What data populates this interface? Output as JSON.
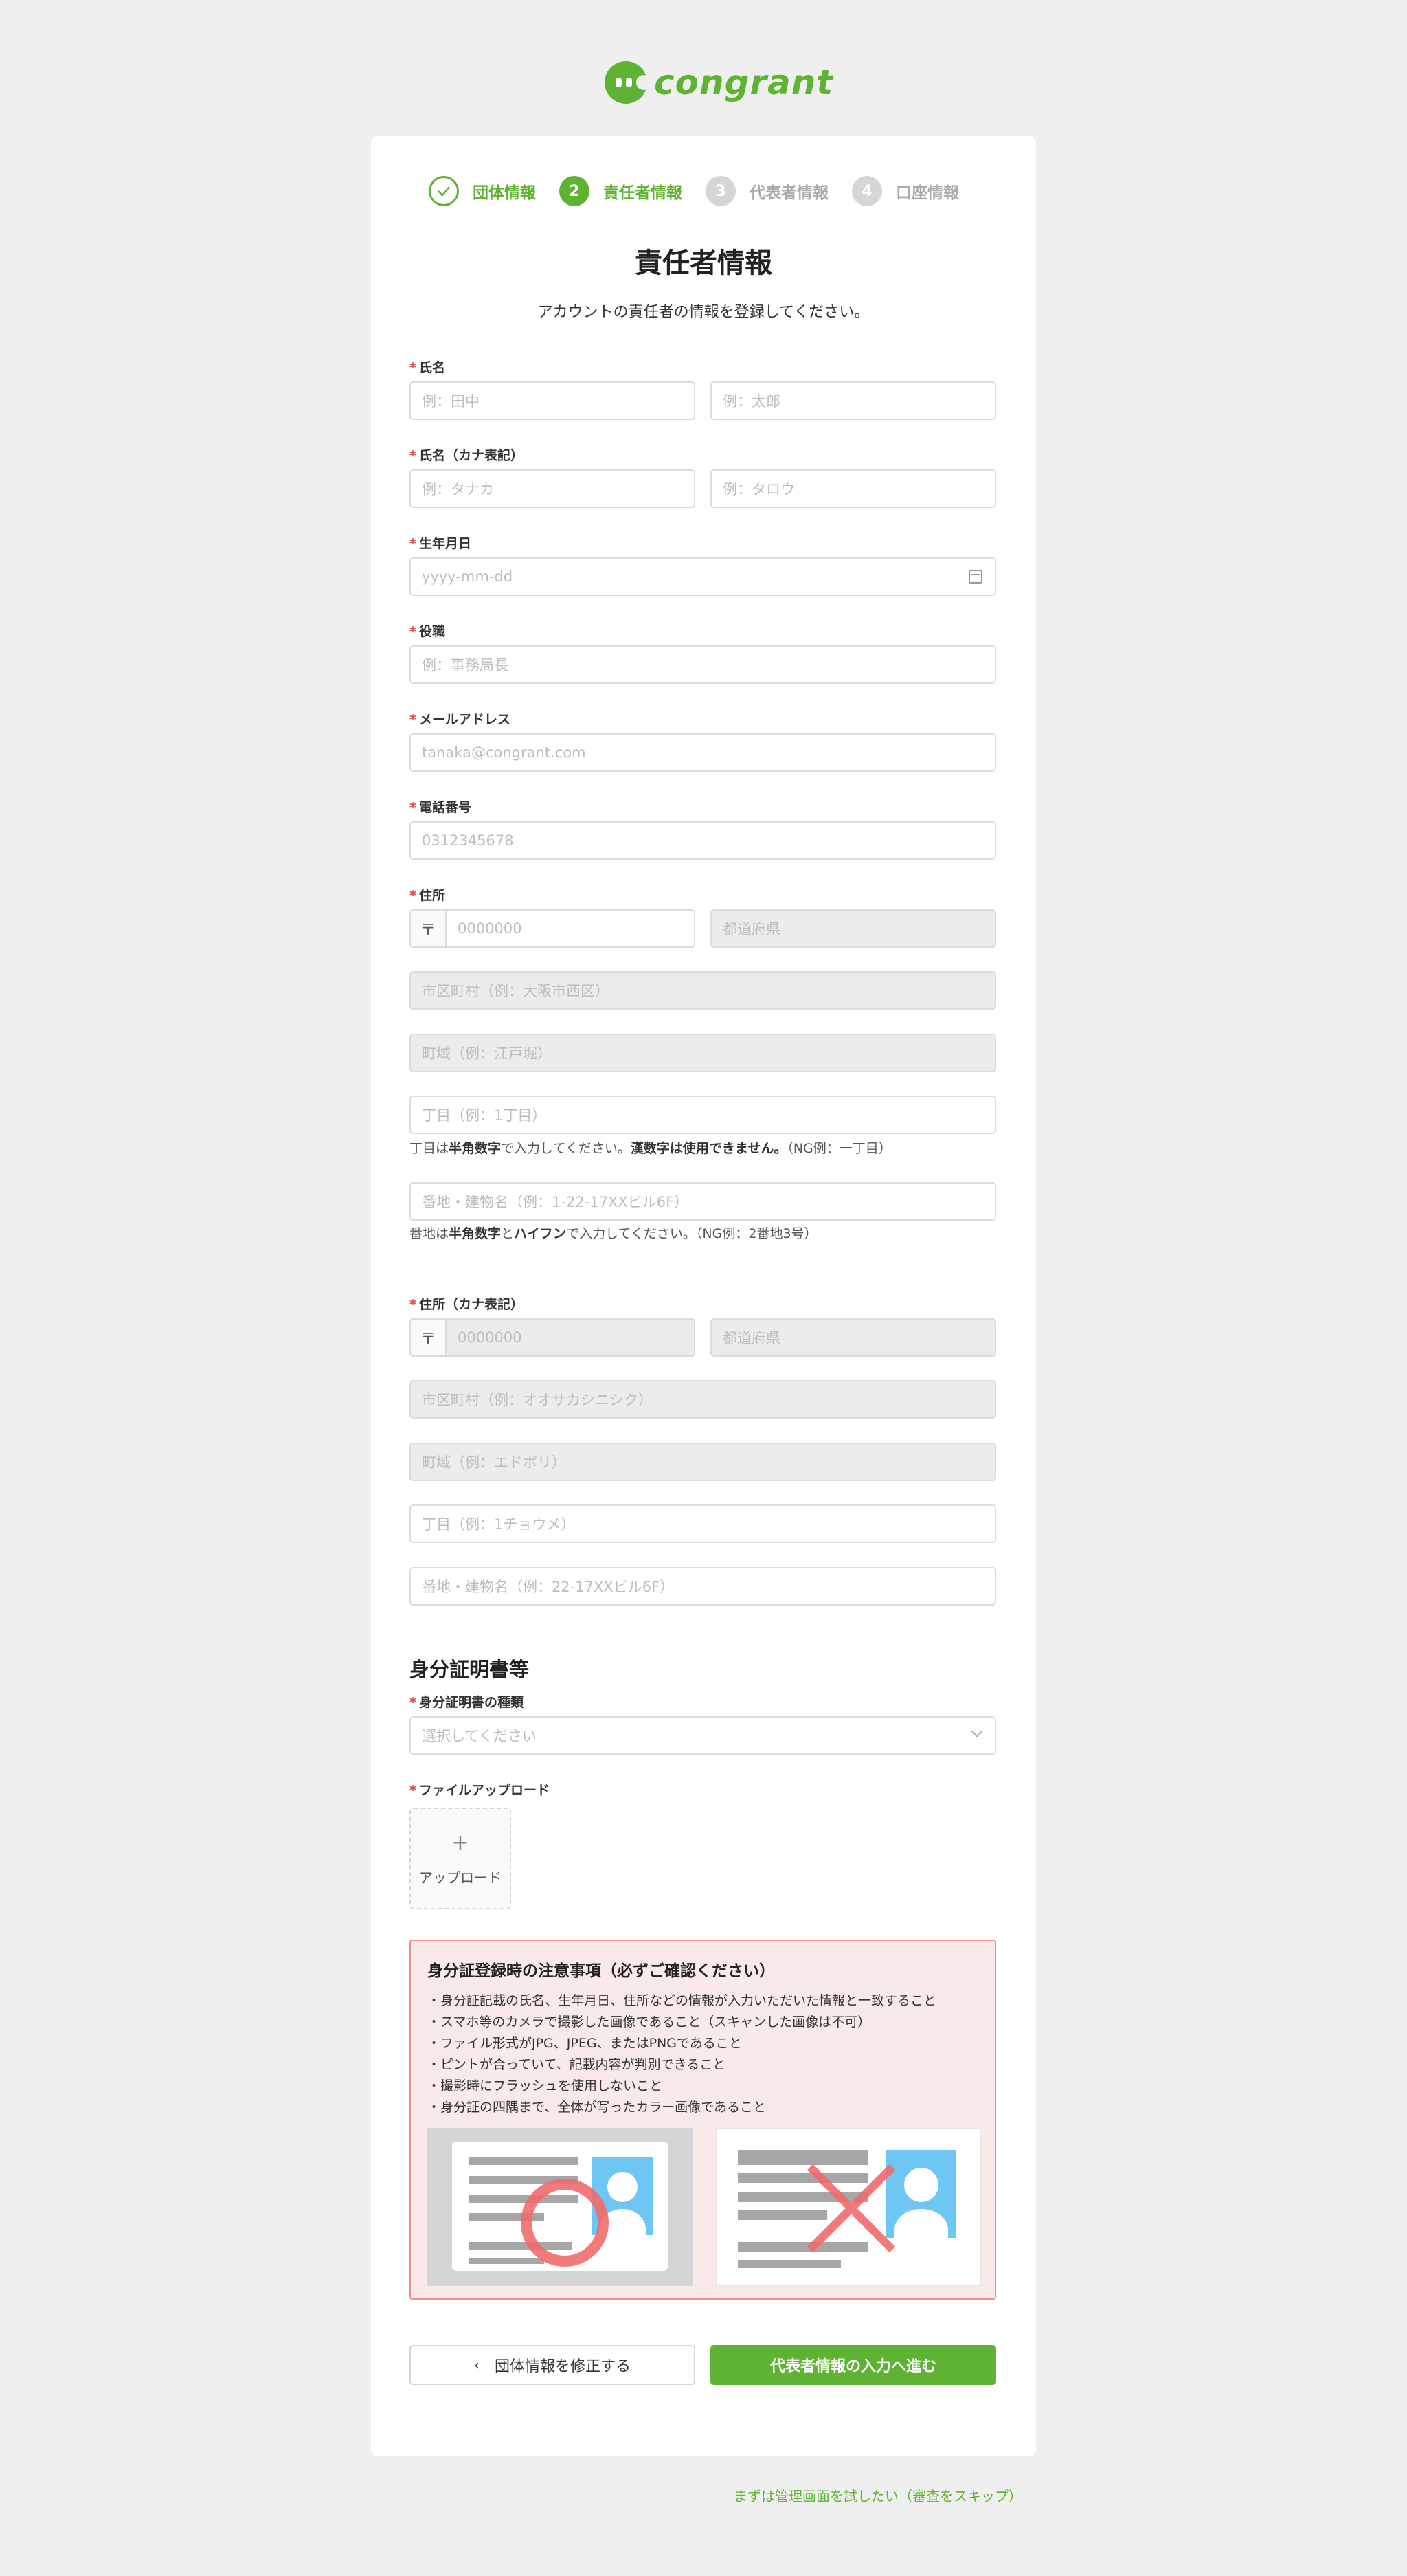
{
  "brand": {
    "name": "congrant",
    "color": "#5fb332"
  },
  "steps": [
    {
      "num": "",
      "label": "団体情報",
      "state": "done"
    },
    {
      "num": "2",
      "label": "責任者情報",
      "state": "active"
    },
    {
      "num": "3",
      "label": "代表者情報",
      "state": "todo"
    },
    {
      "num": "4",
      "label": "口座情報",
      "state": "todo"
    }
  ],
  "page": {
    "title": "責任者情報",
    "subtitle": "アカウントの責任者の情報を登録してください。"
  },
  "form": {
    "name": {
      "label": "氏名",
      "last_placeholder": "例：田中",
      "first_placeholder": "例：太郎"
    },
    "name_kana": {
      "label": "氏名（カナ表記）",
      "last_placeholder": "例：タナカ",
      "first_placeholder": "例：タロウ"
    },
    "birthdate": {
      "label": "生年月日",
      "placeholder": "yyyy-mm-dd"
    },
    "position": {
      "label": "役職",
      "placeholder": "例：事務局長"
    },
    "email": {
      "label": "メールアドレス",
      "placeholder": "tanaka@congrant.com"
    },
    "phone": {
      "label": "電話番号",
      "placeholder": "0312345678"
    },
    "address": {
      "label": "住所",
      "zip_mark": "〒",
      "zip_placeholder": "0000000",
      "pref_placeholder": "都道府県",
      "city_placeholder": "市区町村（例：大阪市西区）",
      "town_placeholder": "町域（例：江戸堀）",
      "chome_placeholder": "丁目（例：1丁目）",
      "chome_help": {
        "pre": "丁目は",
        "b1": "半角数字",
        "mid": "で入力してください。",
        "b2": "漢数字は使用できません。",
        "post": "（NG例：一丁目）"
      },
      "banchi_placeholder": "番地・建物名（例：1-22-17XXビル6F）",
      "banchi_help": {
        "pre": "番地は",
        "b1": "半角数字",
        "mid": "と",
        "b2": "ハイフン",
        "post": "で入力してください。（NG例：2番地3号）"
      }
    },
    "address_kana": {
      "label": "住所（カナ表記）",
      "zip_mark": "〒",
      "zip_placeholder": "0000000",
      "pref_placeholder": "都道府県",
      "city_placeholder": "市区町村（例：オオサカシニシク）",
      "town_placeholder": "町域（例：エドボリ）",
      "chome_placeholder": "丁目（例：1チョウメ）",
      "banchi_placeholder": "番地・建物名（例：22-17XXビル6F）"
    },
    "id_section": {
      "heading": "身分証明書等",
      "type_label": "身分証明書の種類",
      "type_placeholder": "選択してください",
      "upload_label": "ファイルアップロード",
      "upload_plus": "+",
      "upload_text": "アップロード"
    }
  },
  "notice": {
    "title": "身分証登録時の注意事項（必ずご確認ください）",
    "items": [
      "・身分証記載の氏名、生年月日、住所などの情報が入力いただいた情報と一致すること",
      "・スマホ等のカメラで撮影した画像であること（スキャンした画像は不可）",
      "・ファイル形式がJPG、JPEG、またはPNGであること",
      "・ピントが合っていて、記載内容が判別できること",
      "・撮影時にフラッシュを使用しないこと",
      "・身分証の四隅まで、全体が写ったカラー画像であること"
    ],
    "ok_color": "#ef6b6b",
    "photo_color": "#6ec6f3"
  },
  "buttons": {
    "back_icon": "‹",
    "back": "団体情報を修正する",
    "next": "代表者情報の入力へ進む"
  },
  "skip_link": "まずは管理画面を試したい（審査をスキップ）"
}
